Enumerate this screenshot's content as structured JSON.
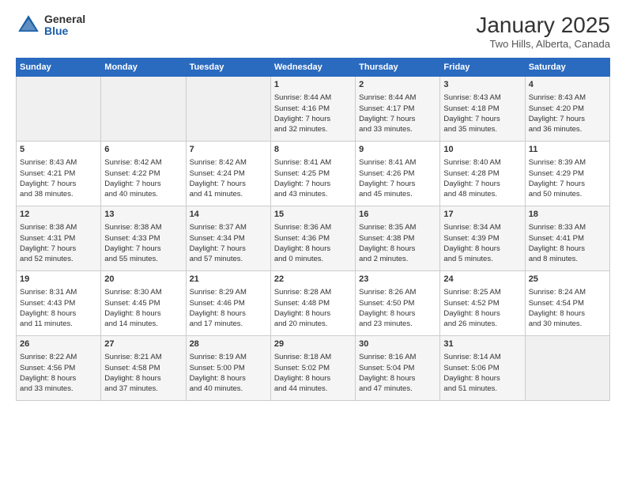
{
  "header": {
    "logo_general": "General",
    "logo_blue": "Blue",
    "title": "January 2025",
    "location": "Two Hills, Alberta, Canada"
  },
  "days_of_week": [
    "Sunday",
    "Monday",
    "Tuesday",
    "Wednesday",
    "Thursday",
    "Friday",
    "Saturday"
  ],
  "weeks": [
    [
      {
        "day": "",
        "info": ""
      },
      {
        "day": "",
        "info": ""
      },
      {
        "day": "",
        "info": ""
      },
      {
        "day": "1",
        "info": "Sunrise: 8:44 AM\nSunset: 4:16 PM\nDaylight: 7 hours\nand 32 minutes."
      },
      {
        "day": "2",
        "info": "Sunrise: 8:44 AM\nSunset: 4:17 PM\nDaylight: 7 hours\nand 33 minutes."
      },
      {
        "day": "3",
        "info": "Sunrise: 8:43 AM\nSunset: 4:18 PM\nDaylight: 7 hours\nand 35 minutes."
      },
      {
        "day": "4",
        "info": "Sunrise: 8:43 AM\nSunset: 4:20 PM\nDaylight: 7 hours\nand 36 minutes."
      }
    ],
    [
      {
        "day": "5",
        "info": "Sunrise: 8:43 AM\nSunset: 4:21 PM\nDaylight: 7 hours\nand 38 minutes."
      },
      {
        "day": "6",
        "info": "Sunrise: 8:42 AM\nSunset: 4:22 PM\nDaylight: 7 hours\nand 40 minutes."
      },
      {
        "day": "7",
        "info": "Sunrise: 8:42 AM\nSunset: 4:24 PM\nDaylight: 7 hours\nand 41 minutes."
      },
      {
        "day": "8",
        "info": "Sunrise: 8:41 AM\nSunset: 4:25 PM\nDaylight: 7 hours\nand 43 minutes."
      },
      {
        "day": "9",
        "info": "Sunrise: 8:41 AM\nSunset: 4:26 PM\nDaylight: 7 hours\nand 45 minutes."
      },
      {
        "day": "10",
        "info": "Sunrise: 8:40 AM\nSunset: 4:28 PM\nDaylight: 7 hours\nand 48 minutes."
      },
      {
        "day": "11",
        "info": "Sunrise: 8:39 AM\nSunset: 4:29 PM\nDaylight: 7 hours\nand 50 minutes."
      }
    ],
    [
      {
        "day": "12",
        "info": "Sunrise: 8:38 AM\nSunset: 4:31 PM\nDaylight: 7 hours\nand 52 minutes."
      },
      {
        "day": "13",
        "info": "Sunrise: 8:38 AM\nSunset: 4:33 PM\nDaylight: 7 hours\nand 55 minutes."
      },
      {
        "day": "14",
        "info": "Sunrise: 8:37 AM\nSunset: 4:34 PM\nDaylight: 7 hours\nand 57 minutes."
      },
      {
        "day": "15",
        "info": "Sunrise: 8:36 AM\nSunset: 4:36 PM\nDaylight: 8 hours\nand 0 minutes."
      },
      {
        "day": "16",
        "info": "Sunrise: 8:35 AM\nSunset: 4:38 PM\nDaylight: 8 hours\nand 2 minutes."
      },
      {
        "day": "17",
        "info": "Sunrise: 8:34 AM\nSunset: 4:39 PM\nDaylight: 8 hours\nand 5 minutes."
      },
      {
        "day": "18",
        "info": "Sunrise: 8:33 AM\nSunset: 4:41 PM\nDaylight: 8 hours\nand 8 minutes."
      }
    ],
    [
      {
        "day": "19",
        "info": "Sunrise: 8:31 AM\nSunset: 4:43 PM\nDaylight: 8 hours\nand 11 minutes."
      },
      {
        "day": "20",
        "info": "Sunrise: 8:30 AM\nSunset: 4:45 PM\nDaylight: 8 hours\nand 14 minutes."
      },
      {
        "day": "21",
        "info": "Sunrise: 8:29 AM\nSunset: 4:46 PM\nDaylight: 8 hours\nand 17 minutes."
      },
      {
        "day": "22",
        "info": "Sunrise: 8:28 AM\nSunset: 4:48 PM\nDaylight: 8 hours\nand 20 minutes."
      },
      {
        "day": "23",
        "info": "Sunrise: 8:26 AM\nSunset: 4:50 PM\nDaylight: 8 hours\nand 23 minutes."
      },
      {
        "day": "24",
        "info": "Sunrise: 8:25 AM\nSunset: 4:52 PM\nDaylight: 8 hours\nand 26 minutes."
      },
      {
        "day": "25",
        "info": "Sunrise: 8:24 AM\nSunset: 4:54 PM\nDaylight: 8 hours\nand 30 minutes."
      }
    ],
    [
      {
        "day": "26",
        "info": "Sunrise: 8:22 AM\nSunset: 4:56 PM\nDaylight: 8 hours\nand 33 minutes."
      },
      {
        "day": "27",
        "info": "Sunrise: 8:21 AM\nSunset: 4:58 PM\nDaylight: 8 hours\nand 37 minutes."
      },
      {
        "day": "28",
        "info": "Sunrise: 8:19 AM\nSunset: 5:00 PM\nDaylight: 8 hours\nand 40 minutes."
      },
      {
        "day": "29",
        "info": "Sunrise: 8:18 AM\nSunset: 5:02 PM\nDaylight: 8 hours\nand 44 minutes."
      },
      {
        "day": "30",
        "info": "Sunrise: 8:16 AM\nSunset: 5:04 PM\nDaylight: 8 hours\nand 47 minutes."
      },
      {
        "day": "31",
        "info": "Sunrise: 8:14 AM\nSunset: 5:06 PM\nDaylight: 8 hours\nand 51 minutes."
      },
      {
        "day": "",
        "info": ""
      }
    ]
  ]
}
